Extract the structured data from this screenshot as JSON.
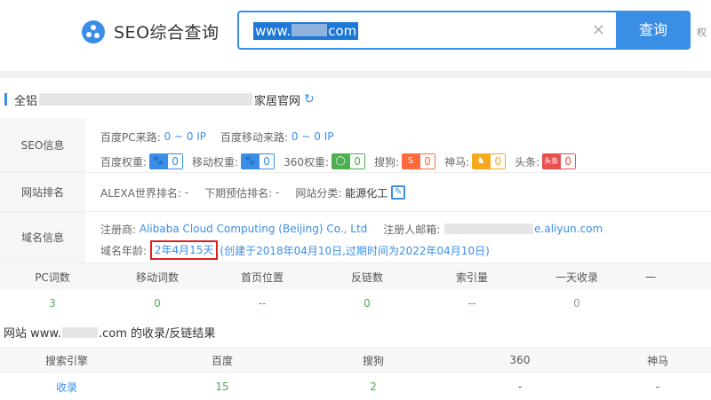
{
  "header": {
    "logo_title": "SEO综合查询",
    "search_value_prefix": "www.",
    "search_value_suffix": "com",
    "search_button": "查询",
    "extra_link": "权"
  },
  "site": {
    "title_prefix": "全铝",
    "title_suffix": "家居官网"
  },
  "seo_info": {
    "label": "SEO信息",
    "baidu_pc_label": "百度PC来路:",
    "baidu_pc_value": "0 ~ 0 IP",
    "baidu_mobile_label": "百度移动来路:",
    "baidu_mobile_value": "0 ~ 0 IP",
    "weights": [
      {
        "label": "百度权重:",
        "icon": "paw-icon",
        "value": "0",
        "color": "#3a8ee6"
      },
      {
        "label": "移动权重:",
        "icon": "paw-icon",
        "value": "0",
        "color": "#3a8ee6"
      },
      {
        "label": "360权重:",
        "icon": "circle-icon",
        "value": "0",
        "color": "#4caf50"
      },
      {
        "label": "搜狗:",
        "icon": "sogou-icon",
        "value": "0",
        "color": "#ff6a3d"
      },
      {
        "label": "神马:",
        "icon": "shenma-icon",
        "value": "0",
        "color": "#f7a81c"
      },
      {
        "label": "头条:",
        "icon": "toutiao-icon",
        "value": "0",
        "color": "#e8504f"
      }
    ],
    "toutiao_icon_text": "头条"
  },
  "rank": {
    "label": "网站排名",
    "alexa_label": "ALEXA世界排名:",
    "alexa_value": "-",
    "forecast_label": "下期预估排名:",
    "forecast_value": "-",
    "category_label": "网站分类:",
    "category_value": "能源化工"
  },
  "domain": {
    "label": "域名信息",
    "registrar_label": "注册商:",
    "registrar_value": "Alibaba Cloud Computing (Beijing) Co., Ltd",
    "email_label": "注册人邮箱:",
    "email_suffix": "e.aliyun.com",
    "age_label": "域名年龄:",
    "age_value": "2年4月15天",
    "age_detail": "(创建于2018年04月10日,过期时间为2022年04月10日)"
  },
  "stats": {
    "headers": [
      "PC词数",
      "移动词数",
      "首页位置",
      "反链数",
      "索引量",
      "一天收录",
      "一"
    ],
    "values": [
      "3",
      "0",
      "--",
      "0",
      "--",
      "0"
    ]
  },
  "results": {
    "title_prefix": "网站 www.",
    "title_suffix": ".com 的收录/反链结果",
    "headers": [
      "搜索引擎",
      "百度",
      "搜狗",
      "360",
      "神马"
    ],
    "row_label": "收录",
    "row_values": [
      "15",
      "2",
      "-",
      "-"
    ]
  }
}
